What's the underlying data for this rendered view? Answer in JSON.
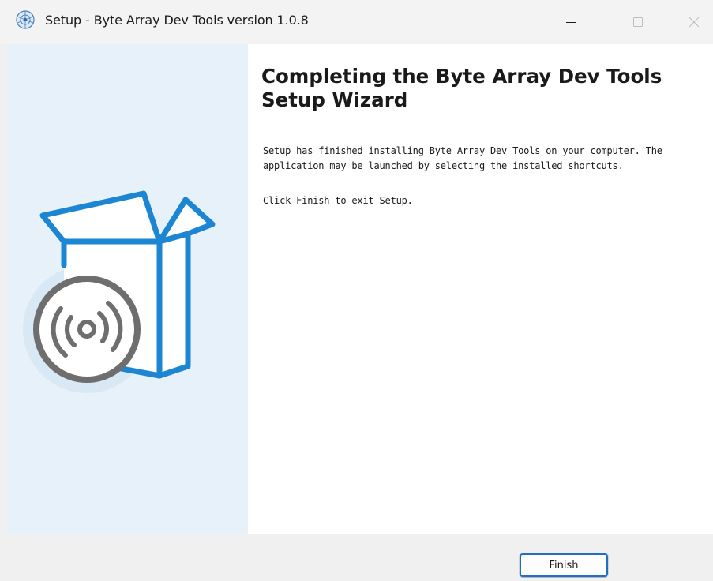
{
  "window": {
    "title": "Setup - Byte Array Dev Tools version 1.0.8",
    "controls": {
      "minimize_icon": "minimize-icon",
      "maximize_icon": "maximize-icon",
      "close_icon": "close-icon"
    },
    "app_icon": "installer-app-icon"
  },
  "wizard": {
    "heading": "Completing the Byte Array Dev Tools Setup Wizard",
    "paragraphs": [
      "Setup has finished installing Byte Array Dev Tools on your computer. The application may be launched by selecting the installed shortcuts.",
      "Click Finish to exit Setup."
    ],
    "illustration": "open-box-with-disc-icon"
  },
  "buttons": {
    "finish_label": "Finish"
  },
  "colors": {
    "side_panel": "#e7f1fa",
    "accent_blue": "#1c86d3",
    "disc_gray": "#707070",
    "focus_outline": "#1f6fc6"
  }
}
